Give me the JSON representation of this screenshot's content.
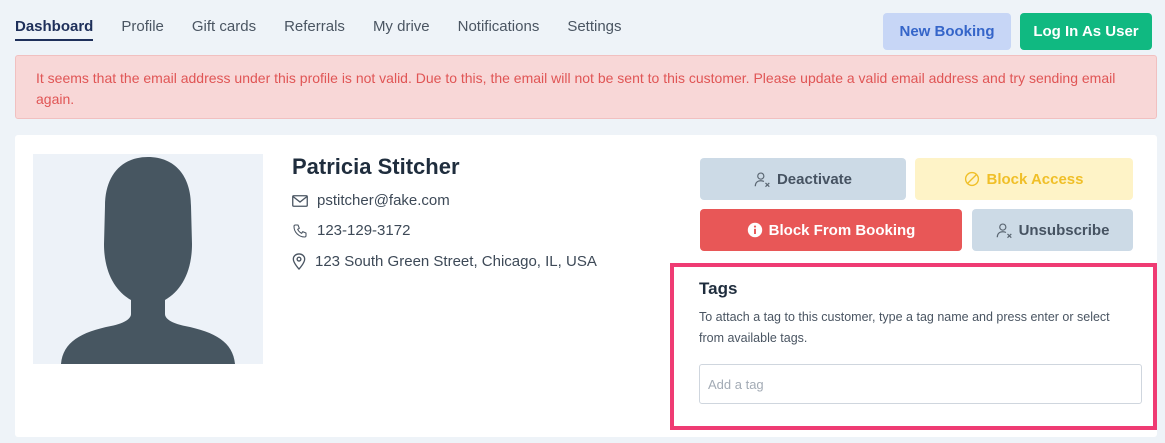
{
  "nav": {
    "items": [
      {
        "label": "Dashboard",
        "active": true
      },
      {
        "label": "Profile",
        "active": false
      },
      {
        "label": "Gift cards",
        "active": false
      },
      {
        "label": "Referrals",
        "active": false
      },
      {
        "label": "My drive",
        "active": false
      },
      {
        "label": "Notifications",
        "active": false
      },
      {
        "label": "Settings",
        "active": false
      }
    ]
  },
  "header": {
    "new_booking_label": "New Booking",
    "login_as_user_label": "Log In As User"
  },
  "alert": {
    "message": "It seems that the email address under this profile is not valid. Due to this, the email will not be sent to this customer. Please update a valid email address and try sending email again."
  },
  "customer": {
    "name": "Patricia Stitcher",
    "email": "pstitcher@fake.com",
    "phone": "123-129-3172",
    "address": "123 South Green Street, Chicago, IL, USA"
  },
  "actions": {
    "deactivate_label": "Deactivate",
    "block_access_label": "Block Access",
    "block_booking_label": "Block From Booking",
    "unsubscribe_label": "Unsubscribe"
  },
  "tags": {
    "title": "Tags",
    "help": "To attach a tag to this customer, type a tag name and press enter or select from available tags.",
    "input_value": "",
    "input_placeholder": "Add a tag"
  },
  "icons": {
    "email": "envelope-icon",
    "phone": "phone-icon",
    "address": "map-pin-icon",
    "deactivate": "user-x-icon",
    "block_access": "ban-icon",
    "block_booking": "info-circle-icon",
    "unsubscribe": "user-x-icon"
  },
  "colors": {
    "accent_nav": "#1e2f5a",
    "new_booking_bg": "#c7d6f6",
    "login_bg": "#10b981",
    "alert_bg": "#f8d7d7",
    "alert_text": "#e05555",
    "block_booking_bg": "#e85757",
    "block_access_bg": "#fef3c7",
    "block_access_text": "#f0bf28",
    "highlight_border": "#ef3b73"
  }
}
